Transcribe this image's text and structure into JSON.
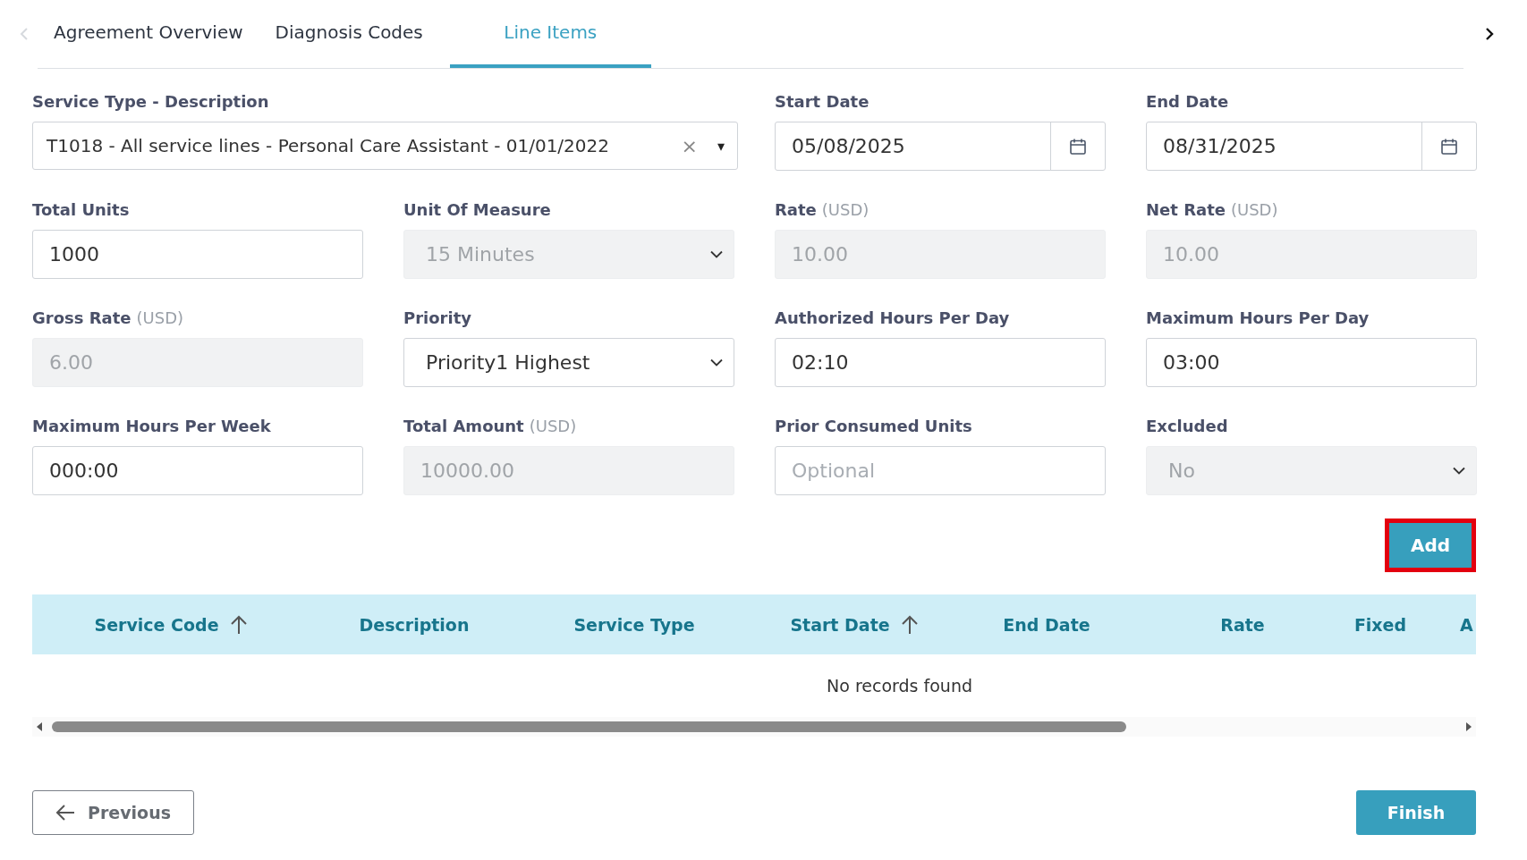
{
  "tabs": [
    {
      "label": "Agreement Overview",
      "selected": false
    },
    {
      "label": "Diagnosis Codes",
      "selected": false
    },
    {
      "label": "Line Items",
      "selected": true
    }
  ],
  "fields": [
    {
      "kind": "combo",
      "label": "Service Type - Description",
      "value": "T1018 - All service lines - Personal Care Assistant - 01/01/2022",
      "clear": "×",
      "caret": "▾"
    },
    {
      "kind": "date",
      "label": "Start Date",
      "value": "05/08/2025"
    },
    {
      "kind": "date",
      "label": "End Date",
      "value": "08/31/2025"
    },
    {
      "kind": "text",
      "label": "Total Units",
      "value": "1000",
      "disabled": false
    },
    {
      "kind": "select",
      "label": "Unit Of Measure",
      "value": "15 Minutes",
      "disabled": true
    },
    {
      "kind": "text",
      "label": "Rate",
      "unit": "(USD)",
      "value": "10.00",
      "disabled": true
    },
    {
      "kind": "text",
      "label": "Net Rate",
      "unit": "(USD)",
      "value": "10.00",
      "disabled": true
    },
    {
      "kind": "text",
      "label": "Gross Rate",
      "unit": "(USD)",
      "value": "6.00",
      "disabled": true
    },
    {
      "kind": "select",
      "label": "Priority",
      "value": "Priority1 Highest",
      "disabled": false
    },
    {
      "kind": "text",
      "label": "Authorized Hours Per Day",
      "value": "02:10",
      "disabled": false
    },
    {
      "kind": "text",
      "label": "Maximum Hours Per Day",
      "value": "03:00",
      "disabled": false
    },
    {
      "kind": "text",
      "label": "Maximum Hours Per Week",
      "value": "000:00",
      "disabled": false
    },
    {
      "kind": "text",
      "label": "Total Amount",
      "unit": "(USD)",
      "value": "10000.00",
      "disabled": true
    },
    {
      "kind": "text",
      "label": "Prior Consumed Units",
      "placeholder": "Optional",
      "disabled": false
    },
    {
      "kind": "select",
      "label": "Excluded",
      "value": "No",
      "disabled": true
    }
  ],
  "add_button": {
    "label": "Add",
    "highlighted": true
  },
  "table": {
    "columns": [
      {
        "label": "Service Code",
        "sorted": true
      },
      {
        "label": "Description",
        "sorted": false
      },
      {
        "label": "Service Type",
        "sorted": false
      },
      {
        "label": "Start Date",
        "sorted": true
      },
      {
        "label": "End Date",
        "sorted": false
      },
      {
        "label": "Rate",
        "sorted": false
      },
      {
        "label": "Fixed",
        "sorted": false
      },
      {
        "label": "A",
        "sorted": false
      }
    ],
    "empty_message": "No records found"
  },
  "footer": {
    "previous": "Previous",
    "finish": "Finish"
  }
}
